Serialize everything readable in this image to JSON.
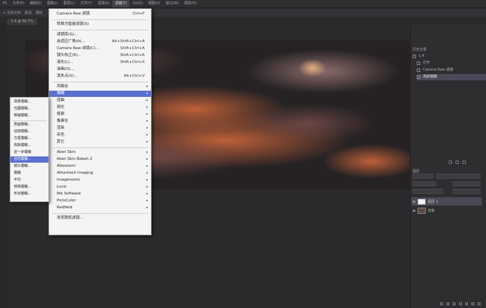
{
  "menubar": {
    "items": [
      "PS",
      "文件(F)",
      "编辑(E)",
      "图像(I)",
      "图层(L)",
      "文字(Y)",
      "选择(S)",
      "滤镜(T)",
      "3D(D)",
      "视图(V)",
      "窗口(W)",
      "帮助(H)"
    ],
    "active_index": 7
  },
  "options_bar": {
    "items": [
      "✕ 当前文档",
      "取消",
      "确定"
    ]
  },
  "document_tab": {
    "label": "1.4 @ 66.7%"
  },
  "filter_menu": {
    "items": [
      {
        "label": "Camera Raw 滤镜",
        "shortcut": "Ctrl+F",
        "sub": false
      },
      {
        "sep": true
      },
      {
        "label": "转换为智能滤镜(S)",
        "shortcut": "",
        "sub": false
      },
      {
        "sep": true
      },
      {
        "label": "滤镜库(G)...",
        "shortcut": "",
        "sub": false
      },
      {
        "label": "自适应广角(A)...",
        "shortcut": "Alt+Shift+Ctrl+A",
        "sub": false
      },
      {
        "label": "Camera Raw 滤镜(C)...",
        "shortcut": "Shift+Ctrl+A",
        "sub": false
      },
      {
        "label": "镜头校正(R)...",
        "shortcut": "Shift+Ctrl+R",
        "sub": false
      },
      {
        "label": "液化(L)...",
        "shortcut": "Shift+Ctrl+X",
        "sub": false
      },
      {
        "label": "油画(O)...",
        "shortcut": "",
        "sub": false
      },
      {
        "label": "消失点(V)...",
        "shortcut": "Alt+Ctrl+V",
        "sub": false
      },
      {
        "sep": true
      },
      {
        "label": "风格化",
        "shortcut": "",
        "sub": true
      },
      {
        "label": "模糊",
        "shortcut": "",
        "sub": true,
        "highlight": true
      },
      {
        "label": "扭曲",
        "shortcut": "",
        "sub": true
      },
      {
        "label": "锐化",
        "shortcut": "",
        "sub": true
      },
      {
        "label": "视频",
        "shortcut": "",
        "sub": true
      },
      {
        "label": "像素化",
        "shortcut": "",
        "sub": true
      },
      {
        "label": "渲染",
        "shortcut": "",
        "sub": true
      },
      {
        "label": "杂色",
        "shortcut": "",
        "sub": true
      },
      {
        "label": "其它",
        "shortcut": "",
        "sub": true
      },
      {
        "sep": true
      },
      {
        "label": "Alien Skin",
        "shortcut": "",
        "sub": true
      },
      {
        "label": "Alien Skin Bokeh 2",
        "shortcut": "",
        "sub": true
      },
      {
        "label": "Alkostomi",
        "shortcut": "",
        "sub": true
      },
      {
        "label": "Athentech Imaging",
        "shortcut": "",
        "sub": true
      },
      {
        "label": "Imagenomic",
        "shortcut": "",
        "sub": true
      },
      {
        "label": "Lucis",
        "shortcut": "",
        "sub": true
      },
      {
        "label": "Nik Software",
        "shortcut": "",
        "sub": true
      },
      {
        "label": "PictoColor",
        "shortcut": "",
        "sub": true
      },
      {
        "label": "Redfield",
        "shortcut": "",
        "sub": true
      },
      {
        "sep": true
      },
      {
        "label": "浏览联机滤镜...",
        "shortcut": "",
        "sub": false
      }
    ]
  },
  "blur_submenu": {
    "items": [
      {
        "label": "场景模糊..."
      },
      {
        "label": "光圈模糊..."
      },
      {
        "label": "移轴模糊..."
      },
      {
        "sep": true
      },
      {
        "label": "表面模糊..."
      },
      {
        "label": "动感模糊..."
      },
      {
        "label": "方框模糊..."
      },
      {
        "label": "高斯模糊..."
      },
      {
        "label": "进一步模糊"
      },
      {
        "label": "径向模糊...",
        "highlight": true
      },
      {
        "label": "镜头模糊..."
      },
      {
        "label": "模糊"
      },
      {
        "label": "平均"
      },
      {
        "label": "特殊模糊..."
      },
      {
        "label": "形状模糊..."
      }
    ]
  },
  "history_panel": {
    "title": "历史记录",
    "rows": [
      {
        "label": "1.4"
      },
      {
        "label": "打开"
      },
      {
        "label": "Camera Raw 滤镜"
      },
      {
        "label": "高斯模糊",
        "selected": true
      }
    ]
  },
  "layers_panel": {
    "title": "图层",
    "rows": [
      {
        "label": "图层 1",
        "selected": true
      },
      {
        "label": "背景"
      }
    ]
  },
  "colors": {
    "highlight": "#5a6fd0",
    "menu_bg": "#f4f4f4",
    "app_bg": "#2b2a2c"
  }
}
